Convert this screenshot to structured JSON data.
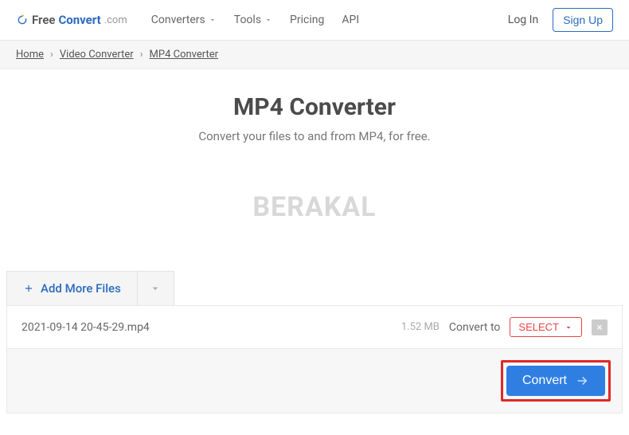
{
  "brand": {
    "free": "Free",
    "convert": "Convert",
    "com": ".com"
  },
  "nav": {
    "converters": "Converters",
    "tools": "Tools",
    "pricing": "Pricing",
    "api": "API"
  },
  "auth": {
    "login": "Log In",
    "signup": "Sign Up"
  },
  "breadcrumb": {
    "home": "Home",
    "video": "Video Converter",
    "current": "MP4 Converter"
  },
  "hero": {
    "title": "MP4 Converter",
    "subtitle": "Convert your files to and from MP4, for free."
  },
  "watermark": "BERAKAL",
  "panel": {
    "add_more": "Add More Files"
  },
  "file": {
    "name": "2021-09-14 20-45-29.mp4",
    "size": "1.52 MB",
    "convert_to": "Convert to",
    "select": "SELECT"
  },
  "action": {
    "convert": "Convert"
  }
}
